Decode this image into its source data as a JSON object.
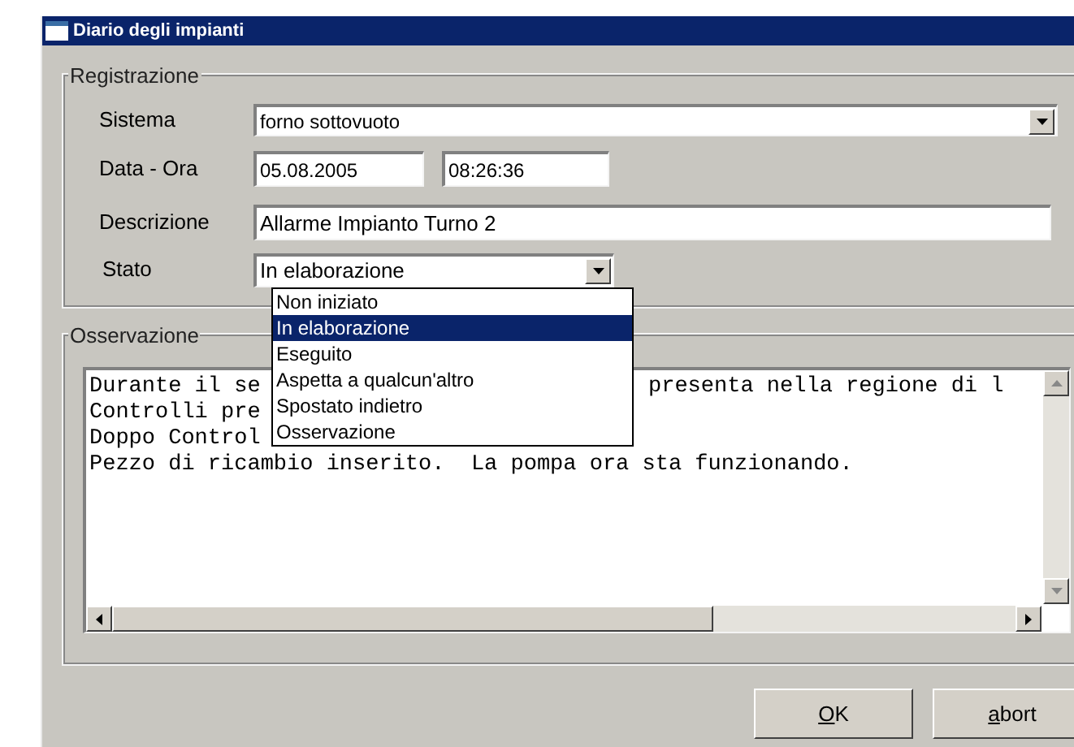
{
  "window": {
    "title": "Diario degli impianti"
  },
  "registration": {
    "title": "Registrazione",
    "system": {
      "label": "Sistema",
      "value": "forno sottovuoto"
    },
    "datetime": {
      "label": "Data - Ora",
      "date": "05.08.2005",
      "time": "08:26:36"
    },
    "description": {
      "label": "Descrizione",
      "value": "Allarme Impianto Turno 2"
    },
    "status": {
      "label": "Stato",
      "value": "In elaborazione",
      "expanded": true,
      "options": [
        {
          "label": "Non iniziato",
          "selected": false
        },
        {
          "label": "In elaborazione",
          "selected": true
        },
        {
          "label": "Eseguito",
          "selected": false
        },
        {
          "label": "Aspetta a qualcun'altro",
          "selected": false
        },
        {
          "label": "Spostato indietro",
          "selected": false
        },
        {
          "label": "Osservazione",
          "selected": false
        }
      ]
    }
  },
  "observation": {
    "title": "Osservazione",
    "lines": [
      {
        "text": "Durante il se",
        "tail": "presenta nella regione di l"
      },
      {
        "text": "Controlli pre"
      },
      {
        "text": "Doppo Control"
      },
      {
        "text": "Pezzo di ricambio inserito.  La pompa ora sta funzionando."
      }
    ]
  },
  "buttons": [
    {
      "label": "OK"
    },
    {
      "label": "abort"
    }
  ]
}
